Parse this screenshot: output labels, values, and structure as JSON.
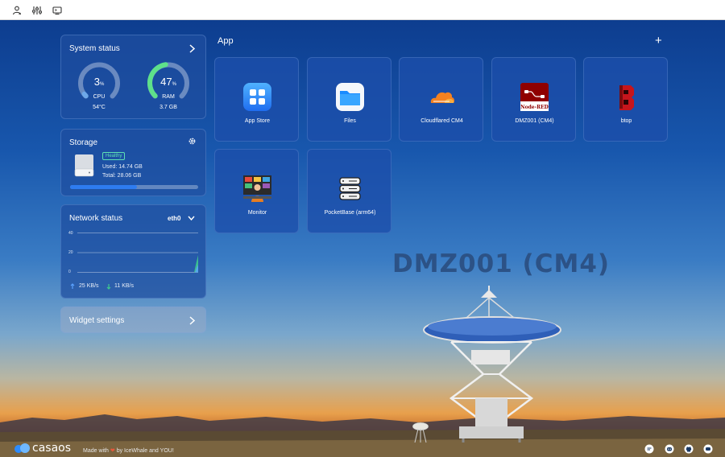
{
  "app_title": "CasaOS",
  "hostname": "DMZ001 (CM4)",
  "colors": {
    "accent": "#2e7cf0",
    "ram_gauge": "#5ee08a",
    "cpu_gauge": "#6ea8e8",
    "healthy": "#5ee0b4"
  },
  "system_status": {
    "title": "System status",
    "cpu": {
      "value": "3",
      "unit": "%",
      "label": "CPU",
      "detail": "54°C",
      "percent": 3
    },
    "ram": {
      "value": "47",
      "unit": "%",
      "label": "RAM",
      "detail": "3.7 GB",
      "percent": 47
    }
  },
  "storage": {
    "title": "Storage",
    "badge": "Healthy",
    "used": "Used: 14.74 GB",
    "total": "Total: 28.06 GB",
    "fill_fraction": 0.525
  },
  "network": {
    "title": "Network status",
    "interface": "eth0",
    "axis": [
      "40",
      "20",
      "0"
    ],
    "upload": "25 KB/s",
    "download": "11 KB/s"
  },
  "widget_settings": {
    "label": "Widget settings"
  },
  "apps": {
    "title": "App",
    "add_label": "+",
    "items": [
      {
        "name": "App Store",
        "icon": "app-store-icon"
      },
      {
        "name": "Files",
        "icon": "folder-icon"
      },
      {
        "name": "Cloudflared CM4",
        "icon": "cloudflare-icon"
      },
      {
        "name": "DMZ001 (CM4)",
        "icon": "node-red-icon",
        "icon_text": "Node-RED"
      },
      {
        "name": "btop",
        "icon": "btop-icon"
      },
      {
        "name": "Monitor",
        "icon": "monitor-icon"
      },
      {
        "name": "PocketBase (arm64)",
        "icon": "database-icon"
      }
    ]
  },
  "footer": {
    "logo_text": "casaos",
    "made_with_prefix": "Made with",
    "made_with_suffix": "by IceWhale and YOU!",
    "icons": [
      "feedback-icon",
      "discord-icon",
      "github-icon",
      "chat-icon"
    ]
  }
}
